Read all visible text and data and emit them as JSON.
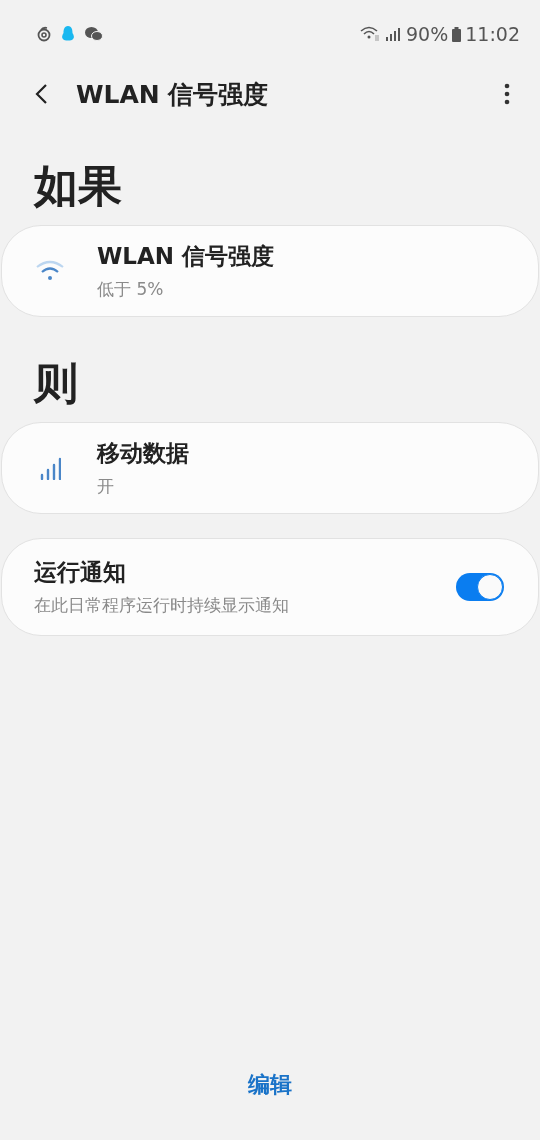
{
  "status_bar": {
    "battery": "90%",
    "time": "11:02"
  },
  "app_bar": {
    "title": "WLAN 信号强度"
  },
  "sections": [
    {
      "heading": "如果",
      "cards": [
        {
          "kind": "wifi",
          "title": "WLAN 信号强度",
          "subtitle": "低于 5%"
        }
      ]
    },
    {
      "heading": "则",
      "cards": [
        {
          "kind": "mobile-data",
          "title": "移动数据",
          "subtitle": "开"
        }
      ]
    }
  ],
  "notification_setting": {
    "title": "运行通知",
    "description": "在此日常程序运行时持续显示通知",
    "on": true
  },
  "bottom_button": "编辑"
}
